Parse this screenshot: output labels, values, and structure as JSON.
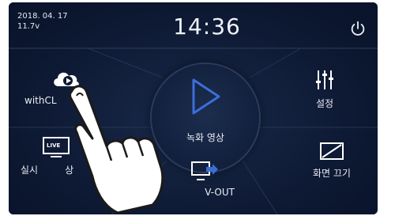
{
  "status_bar": {
    "date": "2018. 04. 17",
    "voltage": "11.7v",
    "time": "14:36"
  },
  "menu": {
    "with_cloud_label": "withCL",
    "settings_label": "설정",
    "record_video_label": "녹화 영상",
    "live_label": "실시",
    "live_label_tail": "상",
    "live_badge": "LIVE",
    "tv_out_label": "V-OUT",
    "screen_off_label": "화면 끄기"
  },
  "colors": {
    "background": "#0c1730",
    "accent": "#3a6fd8",
    "text": "#e9edf3"
  }
}
